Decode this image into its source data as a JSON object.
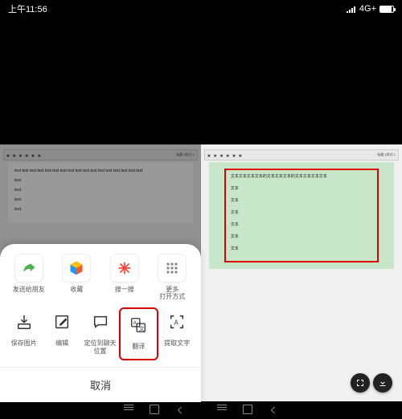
{
  "status": {
    "time_prefix": "上午",
    "time": "11:56",
    "signal": "4G+",
    "signal_icon_hint": "signal-icon"
  },
  "left_document": {
    "toolbar_title": "标题 1样式 1",
    "lines": [
      "test test test test test test test test test test test test test test test test test",
      "test",
      "test",
      "test",
      "test"
    ]
  },
  "right_document": {
    "toolbar_title": "标题 1样式 1",
    "lines": [
      "文本文本文本文本的文本文本文本的文本文本文本文本",
      "文本",
      "文本",
      "文本",
      "文本",
      "文本",
      "文本"
    ]
  },
  "sheet": {
    "row1": [
      {
        "name": "share-forward",
        "label": "发送给朋友",
        "icon": "share-arrow"
      },
      {
        "name": "favorite",
        "label": "收藏",
        "icon": "cube-color"
      },
      {
        "name": "scan",
        "label": "搜一搜",
        "icon": "asterisk-red"
      },
      {
        "name": "open-with",
        "label": "更多\n打开方式",
        "icon": "grid-dots"
      }
    ],
    "row2": [
      {
        "name": "save-image",
        "label": "保存图片",
        "icon": "download-tray"
      },
      {
        "name": "edit",
        "label": "编辑",
        "icon": "edit-square"
      },
      {
        "name": "locate-chat",
        "label": "定位到聊天\n位置",
        "icon": "chat-bubble"
      },
      {
        "name": "translate",
        "label": "翻译",
        "icon": "translate-az",
        "highlighted": true
      },
      {
        "name": "extract-text",
        "label": "提取文字",
        "icon": "ocr-brackets"
      }
    ],
    "cancel": "取消"
  },
  "float": {
    "expand": "expand-icon",
    "save": "download-icon"
  }
}
